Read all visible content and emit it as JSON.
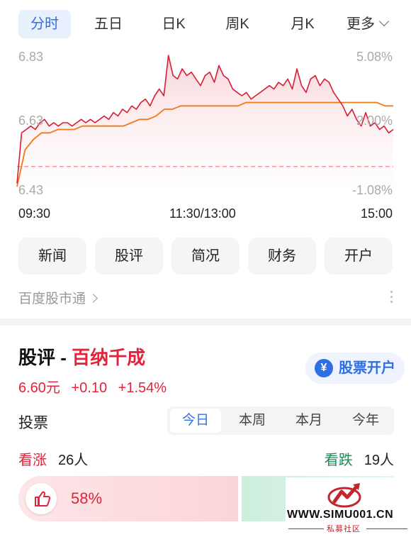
{
  "tabs": {
    "items": [
      "分时",
      "五日",
      "日K",
      "周K",
      "月K"
    ],
    "more": "更多"
  },
  "chart": {
    "price_high": "6.83",
    "price_mid": "6.63",
    "price_low": "6.43",
    "pct_high": "5.08%",
    "pct_mid": "2.00%",
    "pct_low": "-1.08%",
    "time_start": "09:30",
    "time_mid": "11:30/13:00",
    "time_end": "15:00",
    "colors": {
      "price_line": "#d81e34",
      "avg_line": "#f07a1a",
      "prev_close": "#e88a94"
    }
  },
  "chart_data": {
    "type": "line",
    "x_range": [
      "09:30",
      "15:00"
    ],
    "ylim": [
      6.43,
      6.83
    ],
    "y2_labels": [
      "5.08%",
      "2.00%",
      "-1.08%"
    ],
    "series": [
      {
        "values": [
          6.45,
          6.6,
          6.61,
          6.62,
          6.61,
          6.63,
          6.64,
          6.62,
          6.63,
          6.62,
          6.63,
          6.63,
          6.62,
          6.63,
          6.64,
          6.63,
          6.64,
          6.63,
          6.64,
          6.65,
          6.64,
          6.66,
          6.65,
          6.67,
          6.66,
          6.68,
          6.67,
          6.69,
          6.7,
          6.68,
          6.71,
          6.73,
          6.71,
          6.83,
          6.77,
          6.76,
          6.79,
          6.77,
          6.78,
          6.76,
          6.74,
          6.77,
          6.78,
          6.75,
          6.8,
          6.77,
          6.76,
          6.73,
          6.72,
          6.71,
          6.72,
          6.7,
          6.71,
          6.72,
          6.73,
          6.74,
          6.73,
          6.75,
          6.74,
          6.76,
          6.73,
          6.79,
          6.74,
          6.72,
          6.76,
          6.77,
          6.74,
          6.76,
          6.75,
          6.72,
          6.7,
          6.68,
          6.65,
          6.67,
          6.64,
          6.62,
          6.66,
          6.62,
          6.63,
          6.61,
          6.62,
          6.6,
          6.61
        ]
      },
      {
        "values": [
          6.44,
          6.55,
          6.58,
          6.6,
          6.6,
          6.61,
          6.61,
          6.61,
          6.62,
          6.62,
          6.62,
          6.62,
          6.62,
          6.62,
          6.63,
          6.64,
          6.64,
          6.65,
          6.67,
          6.67,
          6.68,
          6.68,
          6.68,
          6.68,
          6.68,
          6.68,
          6.68,
          6.68,
          6.69,
          6.69,
          6.69,
          6.69,
          6.69,
          6.69,
          6.69,
          6.69,
          6.69,
          6.69,
          6.69,
          6.69,
          6.69,
          6.69,
          6.69,
          6.69,
          6.69,
          6.68,
          6.68
        ]
      }
    ],
    "prev_close": 6.5
  },
  "quick_buttons": [
    "新闻",
    "股评",
    "简况",
    "财务",
    "开户"
  ],
  "source": "百度股市通",
  "review": {
    "title_prefix": "股评 - ",
    "stock_name": "百纳千成",
    "price": "6.60元",
    "change": "+0.10",
    "change_pct": "+1.54%",
    "open_account": "股票开户",
    "yen_symbol": "¥"
  },
  "vote": {
    "label": "投票",
    "periods": [
      "今日",
      "本周",
      "本月",
      "今年"
    ],
    "rise_label": "看涨",
    "rise_count": "26人",
    "fall_label": "看跌",
    "fall_count": "19人",
    "rise_pct_text": "58%",
    "rise_pct": 58
  },
  "watermark": {
    "url": "WWW.SIMU001.CN",
    "sub": "私募社区"
  }
}
